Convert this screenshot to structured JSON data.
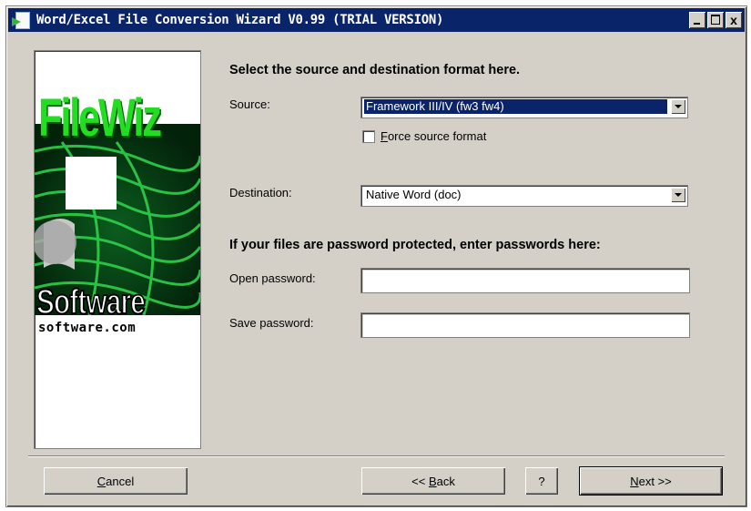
{
  "window": {
    "title": "Word/Excel File Conversion Wizard V0.99 (TRIAL VERSION)",
    "close_glyph": "x"
  },
  "logo": {
    "word": "FileWiz",
    "company": "Software",
    "url": "software.com"
  },
  "form": {
    "heading": "Select the source and destination format here.",
    "source_label": "Source:",
    "source_value": "Framework III/IV (fw3 fw4)",
    "force_checkbox": {
      "mnemonic": "F",
      "rest": "orce source format",
      "checked": false
    },
    "destination_label": "Destination:",
    "destination_value": "Native Word (doc)",
    "password_heading": "If your files are password protected, enter passwords here:",
    "open_password_label": "Open password:",
    "open_password_value": "",
    "save_password_label": "Save password:",
    "save_password_value": ""
  },
  "buttons": {
    "cancel": {
      "mnemonic": "C",
      "rest": "ancel"
    },
    "back": {
      "prefix": "<< ",
      "mnemonic": "B",
      "rest": "ack"
    },
    "help": "?",
    "next": {
      "mnemonic": "N",
      "rest": "ext >>"
    }
  },
  "colors": {
    "titlebar": "#0a246a",
    "face": "#d4d0c8",
    "selection": "#0a246a",
    "logo_green": "#22dd22"
  }
}
